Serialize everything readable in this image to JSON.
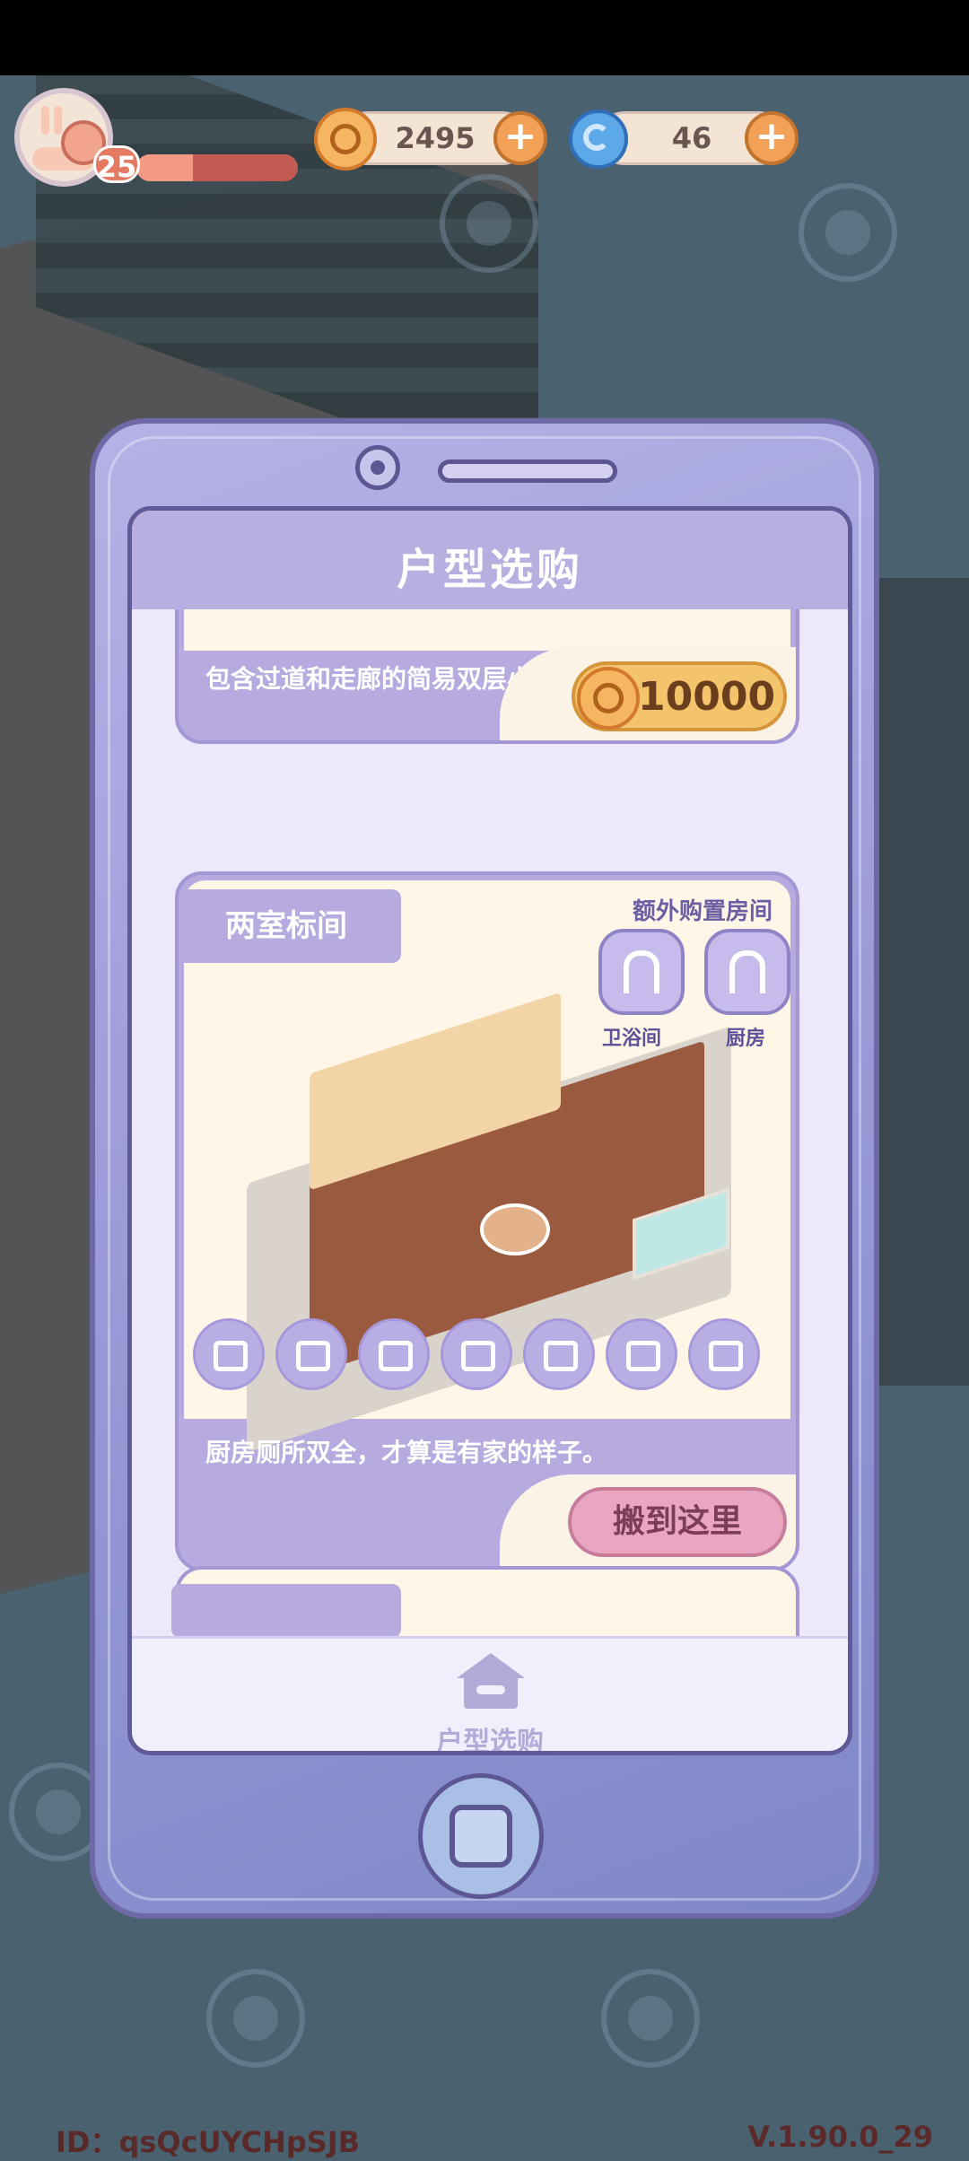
{
  "hud": {
    "level": "25",
    "xp_progress": 0.35,
    "coins": "2495",
    "spirals": "46"
  },
  "panel": {
    "title": "户型选购"
  },
  "cards": [
    {
      "description": "包含过道和走廊的简易双层小家。",
      "price": "10000"
    },
    {
      "name": "两室标间",
      "extra_rooms_label": "额外购置房间",
      "extra_rooms": [
        "卫浴间",
        "厨房"
      ],
      "features": [
        "wallpaper-icon",
        "floor-tile-icon",
        "window-icon",
        "fence-icon",
        "roof-tile-icon",
        "crib-icon",
        "mailbox-icon"
      ],
      "description": "厨房厕所双全，才算是有家的样子。",
      "action_label": "搬到这里"
    }
  ],
  "bottom_nav": {
    "label": "户型选购"
  },
  "footer": {
    "id": "ID：qsQcUYCHpSJB",
    "version": "V.1.90.0_29"
  },
  "colors": {
    "phone": "#9a99d8",
    "coin": "#f4c46c",
    "move_button": "#eaa6c0"
  }
}
